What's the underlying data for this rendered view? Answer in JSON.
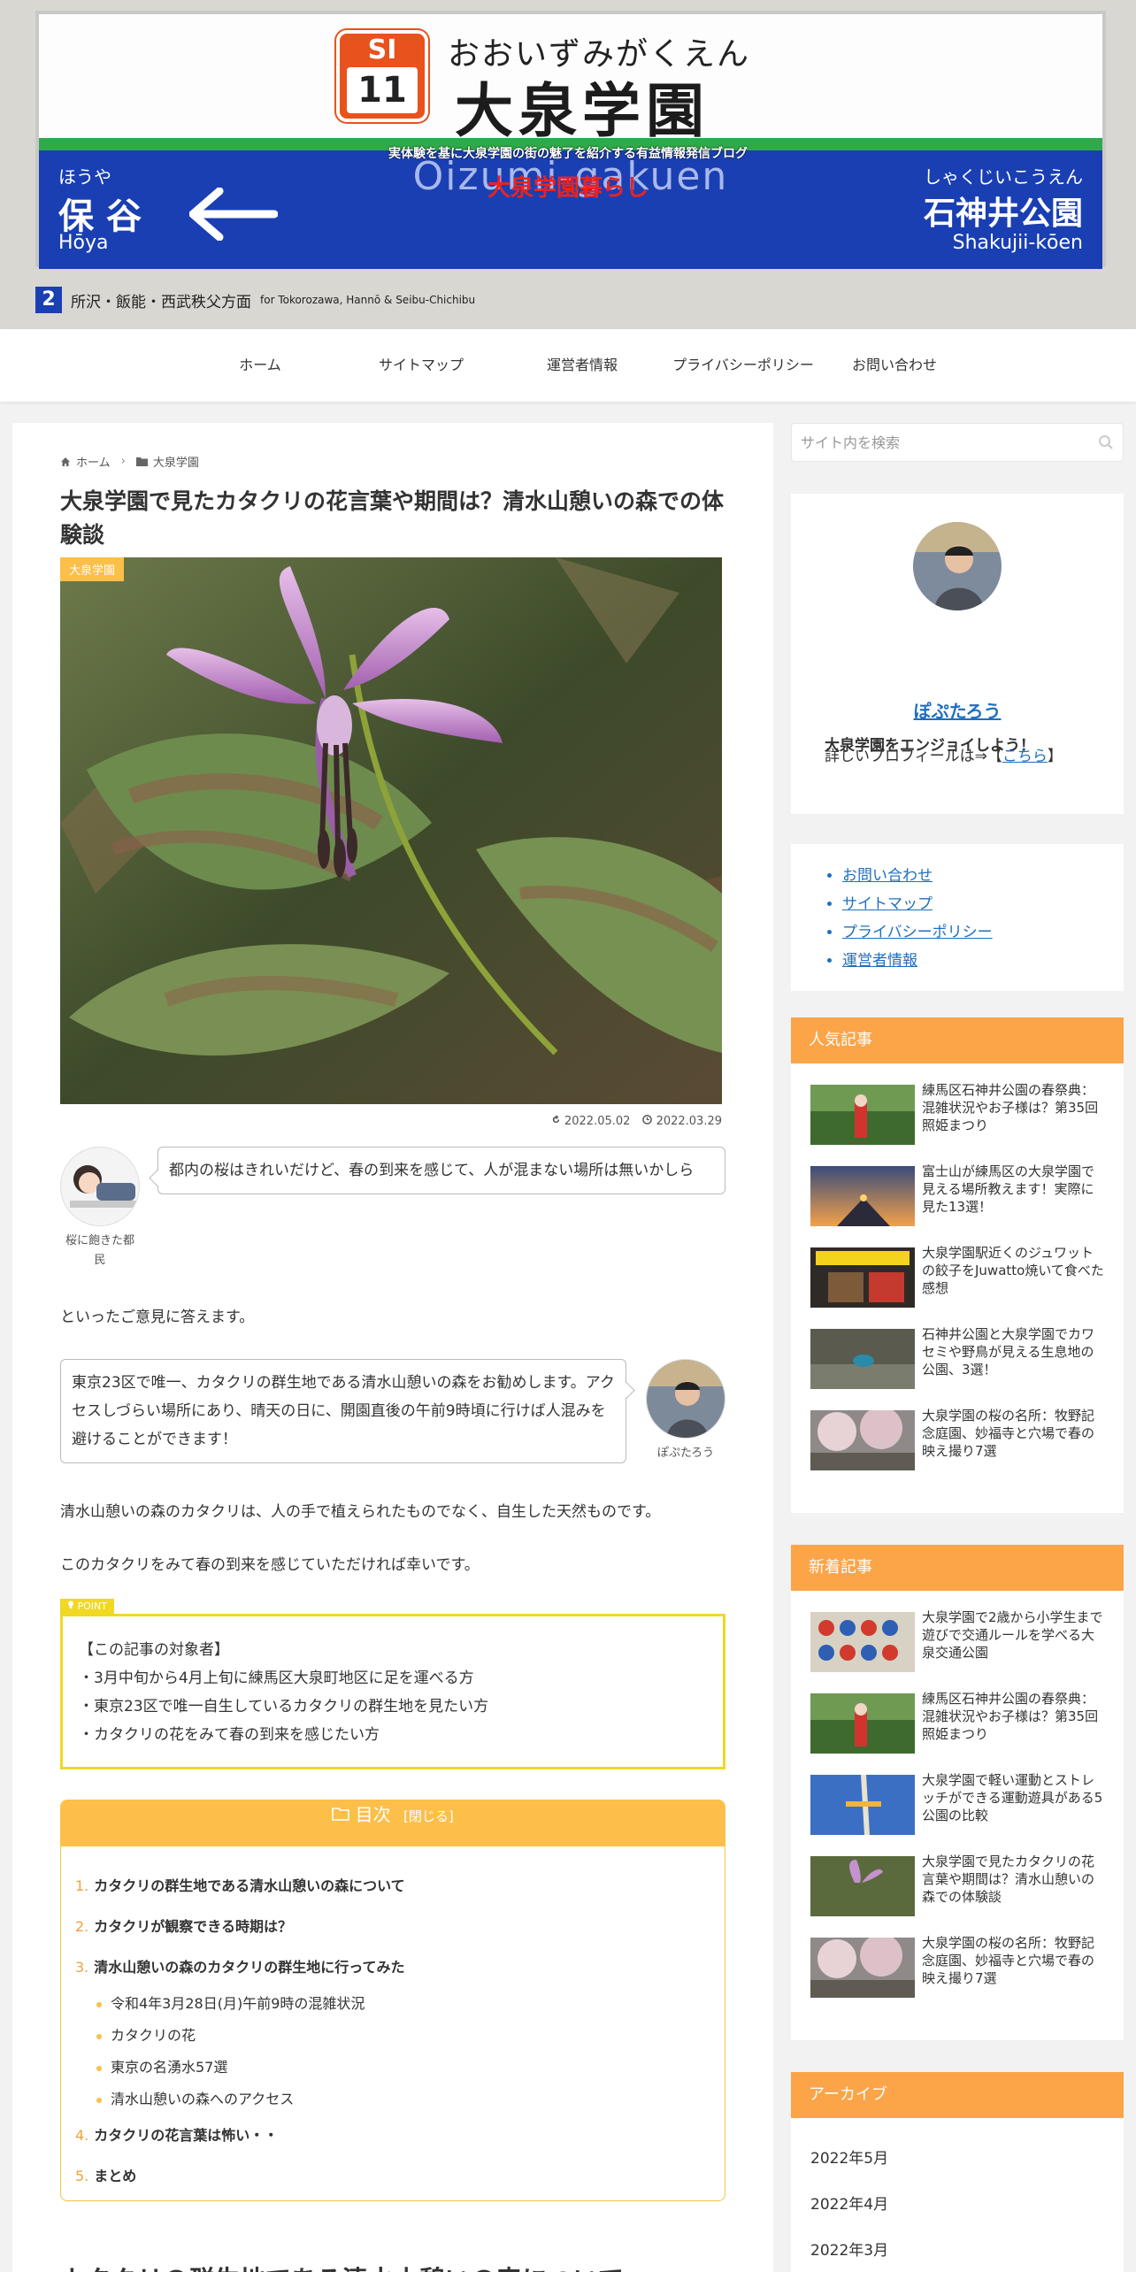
{
  "header": {
    "sign": {
      "number_letters": "SI",
      "number_digits": "11",
      "kana": "おおいずみがくえん",
      "kanji": "大泉学園",
      "romaji": "Oizumi-gakuen",
      "left_kana": "ほうや",
      "left_kanji": "保谷",
      "left_romaji": "Hōya",
      "right_kana": "しゃくじいこうえん",
      "right_kanji": "石神井公園",
      "right_romaji": "Shakujii-kōen",
      "platform_number": "2",
      "destination": "所沢・飯能・西武秩父方面",
      "destination_en": "for Tokorozawa, Hannō & Seibu-Chichibu"
    },
    "site_description": "実体験を基に大泉学園の街の魅了を紹介する有益情報発信ブログ",
    "site_title": "大泉学園暮らし"
  },
  "nav": {
    "items": [
      "ホーム",
      "サイトマップ",
      "運営者情報",
      "プライバシーポリシー",
      "お問い合わせ"
    ]
  },
  "article": {
    "breadcrumb": {
      "home": "ホーム",
      "category": "大泉学園"
    },
    "title": "大泉学園で見たカタクリの花言葉や期間は？清水山憩いの森での体験談",
    "category_label": "大泉学園",
    "updated": "2022.05.02",
    "published": "2022.03.29",
    "balloon1": {
      "name": "桜に飽きた都民",
      "text": "都内の桜はきれいだけど、春の到来を感じて、人が混まない場所は無いかしら"
    },
    "para1": "といったご意見に答えます。",
    "balloon2": {
      "name": "ぽぷたろう",
      "text": "東京23区で唯一、カタクリの群生地である清水山憩いの森をお勧めします。アクセスしづらい場所にあり、晴天の日に、開園直後の午前9時頃に行けば人混みを避けることができます！"
    },
    "para2": "清水山憩いの森のカタクリは、人の手で植えられたものでなく、自生した天然ものです。",
    "para3": "このカタクリをみて春の到来を感じていただければ幸いです。",
    "point": {
      "label": "POINT",
      "lines": [
        "【この記事の対象者】",
        "・3月中旬から4月上旬に練馬区大泉町地区に足を運べる方",
        "・東京23区で唯一自生しているカタクリの群生地を見たい方",
        "・カタクリの花をみて春の到来を感じたい方"
      ]
    },
    "toc": {
      "title": "目次",
      "toggle": "[閉じる]",
      "items": [
        {
          "no": "1.",
          "text": "カタクリの群生地である清水山憩いの森について"
        },
        {
          "no": "2.",
          "text": "カタクリが観察できる時期は？"
        },
        {
          "no": "3.",
          "text": "清水山憩いの森のカタクリの群生地に行ってみた"
        },
        {
          "text": "令和4年3月28日(月)午前9時の混雑状況"
        },
        {
          "text": "カタクリの花"
        },
        {
          "text": "東京の名湧水57選"
        },
        {
          "text": "清水山憩いの森へのアクセス"
        },
        {
          "no": "4.",
          "text": "カタクリの花言葉は怖い・・"
        },
        {
          "no": "5.",
          "text": "まとめ"
        }
      ]
    },
    "next_heading": "カタクリの群生地である清水山憩いの森について"
  },
  "sidebar": {
    "search_placeholder": "サイト内を検索",
    "profile": {
      "name": "ぽぷたろう",
      "tagline": "大泉学園をエンジョイしよう！",
      "more_prefix": "詳しいプロフィールは⇒【",
      "more_link": "こちら",
      "more_suffix": "】"
    },
    "links": [
      "お問い合わせ",
      "サイトマップ",
      "プライバシーポリシー",
      "運営者情報"
    ],
    "popular": {
      "title": "人気記事",
      "items": [
        "練馬区石神井公園の春祭典：混雑状況やお子様は？第35回照姫まつり",
        "富士山が練馬区の大泉学園で見える場所教えます！実際に見た13選！",
        "大泉学園駅近くのジュワットの餃子をJuwatto焼いて食べた感想",
        "石神井公園と大泉学園でカワセミや野鳥が見える生息地の公園、3選！",
        "大泉学園の桜の名所：牧野記念庭園、妙福寺と穴場で春の映え撮り7選"
      ]
    },
    "newest": {
      "title": "新着記事",
      "items": [
        "大泉学園で2歳から小学生まで遊びで交通ルールを学べる大泉交通公園",
        "練馬区石神井公園の春祭典：混雑状況やお子様は？第35回照姫まつり",
        "大泉学園で軽い運動とストレッチができる運動遊具がある5公園の比較",
        "大泉学園で見たカタクリの花言葉や期間は？清水山憩いの森での体験談",
        "大泉学園の桜の名所：牧野記念庭園、妙福寺と穴場で春の映え撮り7選"
      ]
    },
    "archive": {
      "title": "アーカイブ",
      "items": [
        "2022年5月",
        "2022年4月",
        "2022年3月"
      ]
    }
  },
  "colors": {
    "accent": "#fca448",
    "toc": "#fcbf49",
    "point": "#f0d823",
    "link": "#1e6fbf",
    "site_title": "#e82323"
  }
}
